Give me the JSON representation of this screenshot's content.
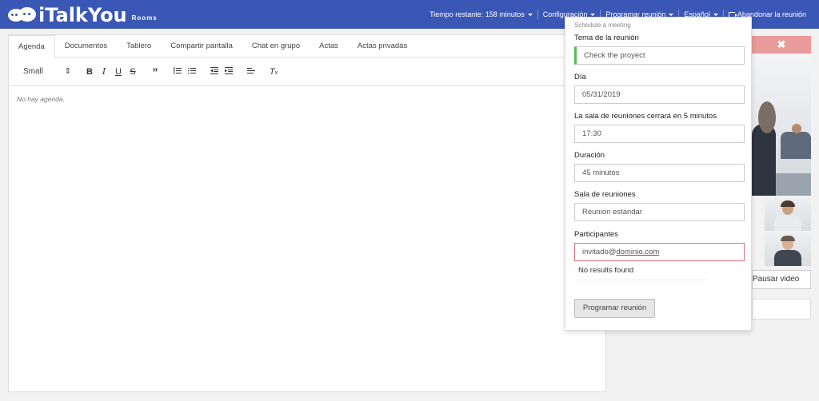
{
  "brand": {
    "name": "iTalkYou",
    "sub": "Rooms"
  },
  "topnav": {
    "time_remaining": "Tiempo restante: 158 minutos",
    "config": "Configuración",
    "schedule": "Programar reunión",
    "language": "Español",
    "leave": "Abandonar la reunión"
  },
  "tabs": [
    "Agenda",
    "Documentos",
    "Tablero",
    "Compartir pantalla",
    "Chat en grupo",
    "Actas",
    "Actas privadas"
  ],
  "toolbar": {
    "size_select": "Small",
    "size_arrow": "⇕"
  },
  "editor": {
    "placeholder": "No hay agenda."
  },
  "rightpanel": {
    "close": "✖",
    "pause_video": "Pausar video"
  },
  "schedule_form": {
    "caption": "Schedule a meeting",
    "topic_label": "Tema de la reunión",
    "topic_value": "Check the proyect",
    "day_label": "Día",
    "day_value": "05/31/2019",
    "close_label": "La sala de reuniones cerrará en 5 minutos",
    "close_value": "17:30",
    "duration_label": "Duración",
    "duration_value": "45 minutos",
    "room_label": "Sala de reuniones",
    "room_value": "Reunión estándar",
    "participants_label": "Participantes",
    "participants_value_prefix": "invitado@",
    "participants_value_underlined": "dominio.com",
    "no_results": "No results found",
    "submit": "Programar reunión"
  },
  "colors": {
    "topbar": "#3a57b5",
    "close": "#e99a9a",
    "valid": "#5cb85c",
    "invalid": "#e07080"
  }
}
